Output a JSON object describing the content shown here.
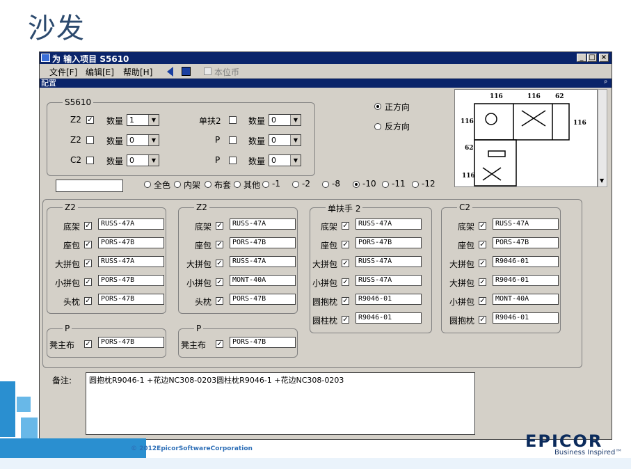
{
  "slide_title": "沙发",
  "window": {
    "title": "为 输入项目 S5610",
    "menu": [
      "文件[F]",
      "编辑[E]",
      "帮助[H]"
    ],
    "currency_label": "本位币",
    "config_label": "配置"
  },
  "top_group": {
    "title": "S5610",
    "rows": [
      {
        "left_label": "Z2",
        "left_checked": true,
        "left_qty_label": "数量",
        "left_qty": "1",
        "right_label": "单扶2",
        "right_checked": false,
        "right_qty_label": "数量",
        "right_qty": "0"
      },
      {
        "left_label": "Z2",
        "left_checked": false,
        "left_qty_label": "数量",
        "left_qty": "0",
        "right_label": "P",
        "right_checked": false,
        "right_qty_label": "数量",
        "right_qty": "0"
      },
      {
        "left_label": "C2",
        "left_checked": false,
        "left_qty_label": "数量",
        "left_qty": "0",
        "right_label": "P",
        "right_checked": false,
        "right_qty_label": "数量",
        "right_qty": "0"
      }
    ]
  },
  "direction": {
    "options": [
      "正方向",
      "反方向"
    ],
    "selected": 0
  },
  "color_options": {
    "items": [
      "全色",
      "内架",
      "布套",
      "其他",
      "-1",
      "-2",
      "-8",
      "-10",
      "-11",
      "-12"
    ],
    "selected": "-10"
  },
  "diagram": {
    "dims": [
      "116",
      "116",
      "62",
      "116",
      "116",
      "62",
      "116"
    ]
  },
  "groups": [
    {
      "title": "Z2",
      "rows": [
        [
          "底架",
          "RUSS-47A"
        ],
        [
          "座包",
          "PORS-47B"
        ],
        [
          "大拼包",
          "RUSS-47A"
        ],
        [
          "小拼包",
          "PORS-47B"
        ],
        [
          "头枕",
          "PORS-47B"
        ]
      ]
    },
    {
      "title": "Z2",
      "rows": [
        [
          "底架",
          "RUSS-47A"
        ],
        [
          "座包",
          "PORS-47B"
        ],
        [
          "大拼包",
          "RUSS-47A"
        ],
        [
          "小拼包",
          "MONT-40A"
        ],
        [
          "头枕",
          "PORS-47B"
        ]
      ]
    },
    {
      "title": "单扶手 2",
      "rows": [
        [
          "底架",
          "RUSS-47A"
        ],
        [
          "座包",
          "PORS-47B"
        ],
        [
          "大拼包",
          "RUSS-47A"
        ],
        [
          "小拼包",
          "RUSS-47A"
        ],
        [
          "圆抱枕",
          "R9046-01"
        ],
        [
          "圆柱枕",
          "R9046-01"
        ]
      ]
    },
    {
      "title": "C2",
      "rows": [
        [
          "底架",
          "RUSS-47A"
        ],
        [
          "座包",
          "PORS-47B"
        ],
        [
          "大拼包",
          "R9046-01"
        ],
        [
          "大拼包",
          "R9046-01"
        ],
        [
          "小拼包",
          "MONT-40A"
        ],
        [
          "圆抱枕",
          "R9046-01"
        ]
      ]
    }
  ],
  "p_groups": [
    {
      "title": "P",
      "label": "凳主布",
      "value": "PORS-47B"
    },
    {
      "title": "P",
      "label": "凳主布",
      "value": "PORS-47B"
    }
  ],
  "remark": {
    "label": "备注:",
    "value": "圆抱枕R9046-1 +花边NC308-0203圆柱枕R9046-1 +花边NC308-0203"
  },
  "footer": {
    "copyright": "© 2012EpicorSoftwareCorporation",
    "brand": "EPICOR",
    "tagline": "Business Inspired™"
  }
}
